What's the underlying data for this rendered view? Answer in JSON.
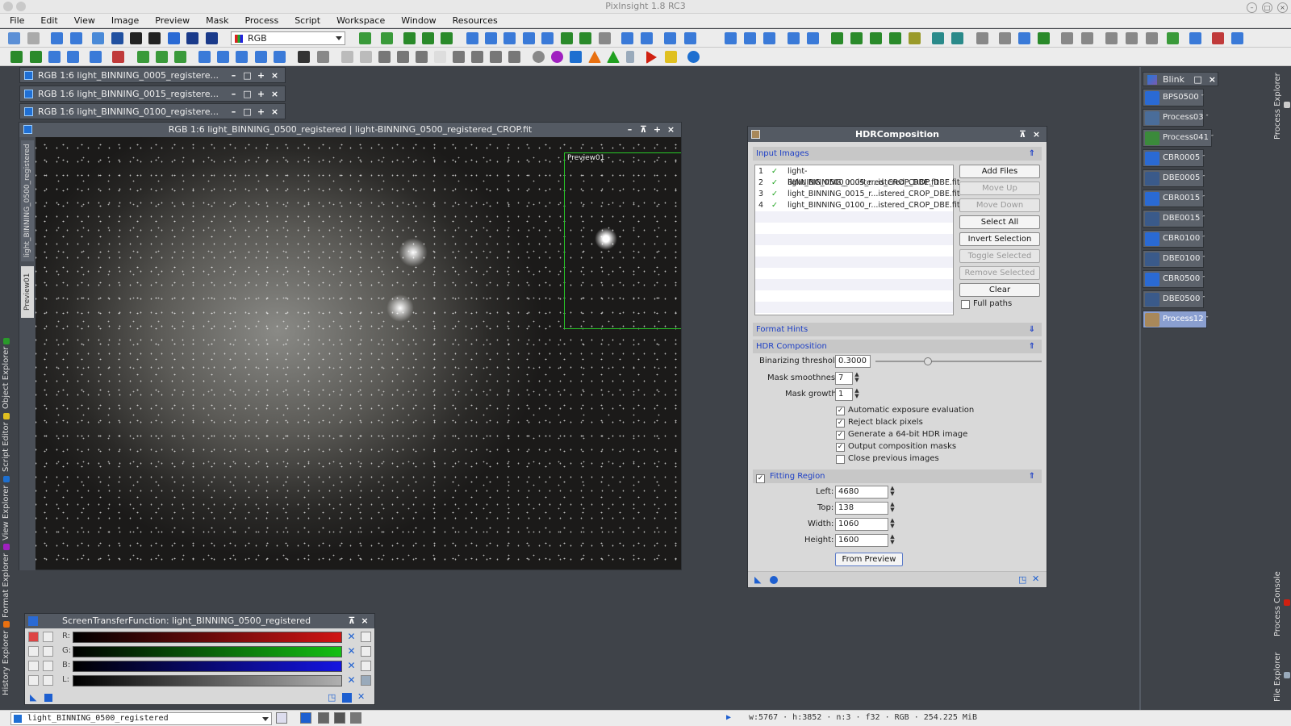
{
  "app": {
    "title": "PixInsight 1.8 RC3"
  },
  "menu": [
    "File",
    "Edit",
    "View",
    "Image",
    "Preview",
    "Mask",
    "Process",
    "Script",
    "Workspace",
    "Window",
    "Resources"
  ],
  "toolbar": {
    "color_mode": "RGB"
  },
  "left_tabs": [
    "Object Explorer",
    "Script Editor",
    "View Explorer",
    "Format Explorer",
    "History Explorer"
  ],
  "right_tabs": [
    "Process Explorer",
    "Process Console",
    "File Explorer"
  ],
  "icon_windows": [
    "RGB 1:6 light_BINNING_0005_registere...",
    "RGB 1:6 light_BINNING_0015_registere...",
    "RGB 1:6 light_BINNING_0100_registere..."
  ],
  "image_window": {
    "title": "RGB 1:6 light_BINNING_0500_registered | light-BINNING_0500_registered_CROP.fit",
    "side_tab": "light_BINNING_0500_registered",
    "preview_tab": "Preview01",
    "preview_label": "Preview01"
  },
  "stf": {
    "title": "ScreenTransferFunction: light_BINNING_0500_registered",
    "channels": [
      {
        "label": "R:",
        "color": "#d01414"
      },
      {
        "label": "G:",
        "color": "#14c014"
      },
      {
        "label": "B:",
        "color": "#1414e0"
      },
      {
        "label": "L:",
        "color": "#b0b0b0"
      }
    ]
  },
  "hdr": {
    "title": "HDRComposition",
    "input_images_label": "Input Images",
    "files": [
      {
        "index": "1",
        "name": "light-BINNING_0500_r...istered_CROP_DBE.fit"
      },
      {
        "index": "2",
        "name": "light_BINNING_0005_r...istered_CROP_DBE.fit"
      },
      {
        "index": "3",
        "name": "light_BINNING_0015_r...istered_CROP_DBE.fit"
      },
      {
        "index": "4",
        "name": "light_BINNING_0100_r...istered_CROP_DBE.fit"
      }
    ],
    "buttons": {
      "add_files": "Add Files",
      "move_up": "Move Up",
      "move_down": "Move Down",
      "select_all": "Select All",
      "invert_selection": "Invert Selection",
      "toggle_selected": "Toggle Selected",
      "remove_selected": "Remove Selected",
      "clear": "Clear",
      "from_preview": "From Preview"
    },
    "full_paths_label": "Full paths",
    "format_hints_label": "Format Hints",
    "hdr_composition_label": "HDR Composition",
    "binarizing_threshold_label": "Binarizing threshold:",
    "binarizing_threshold_value": "0.3000",
    "mask_smoothness_label": "Mask smoothness:",
    "mask_smoothness_value": "7",
    "mask_growth_label": "Mask growth:",
    "mask_growth_value": "1",
    "options": [
      {
        "label": "Automatic exposure evaluation",
        "checked": true
      },
      {
        "label": "Reject black pixels",
        "checked": true
      },
      {
        "label": "Generate a 64-bit HDR image",
        "checked": true
      },
      {
        "label": "Output composition masks",
        "checked": true
      },
      {
        "label": "Close previous images",
        "checked": false
      }
    ],
    "fitting_region_label": "Fitting Region",
    "fitting": {
      "left_label": "Left:",
      "left": "4680",
      "top_label": "Top:",
      "top": "138",
      "width_label": "Width:",
      "width": "1060",
      "height_label": "Height:",
      "height": "1600"
    }
  },
  "blink": {
    "title": "Blink"
  },
  "process_icons": [
    {
      "label": "BPS0500",
      "color": "#2a6ad4"
    },
    {
      "label": "Process03",
      "color": "#4a6d9a"
    },
    {
      "label": "Process041",
      "color": "#3b8a3b"
    },
    {
      "label": "CBR0005",
      "color": "#2a6ad4"
    },
    {
      "label": "DBE0005",
      "color": "#3a5a8a"
    },
    {
      "label": "CBR0015",
      "color": "#2a6ad4"
    },
    {
      "label": "DBE0015",
      "color": "#3a5a8a"
    },
    {
      "label": "CBR0100",
      "color": "#2a6ad4"
    },
    {
      "label": "DBE0100",
      "color": "#3a5a8a"
    },
    {
      "label": "CBR0500",
      "color": "#2a6ad4"
    },
    {
      "label": "DBE0500",
      "color": "#3a5a8a"
    },
    {
      "label": "Process12",
      "color": "#a8885a"
    }
  ],
  "status": {
    "view": "light_BINNING_0500_registered",
    "info": "w:5767 · h:3852 · n:3 · f32 · RGB · 254.225 MiB"
  }
}
